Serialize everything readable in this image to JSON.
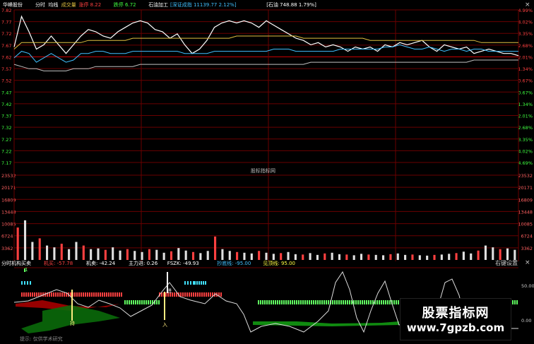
{
  "header": {
    "stock_name": "华峰股份",
    "items": [
      {
        "text": "分时",
        "color": "#ffffff"
      },
      {
        "text": "均线",
        "color": "#ffffff"
      },
      {
        "text": "成交量",
        "color": "#e0c040"
      },
      {
        "text": "涨停 8.22",
        "color": "#ff4040"
      },
      {
        "text": "跌停 6.72",
        "color": "#40ff40"
      },
      {
        "text": "石油加工",
        "color": "#ffffff"
      },
      {
        "text": "[深证成指 11139.77 2.12%]",
        "color": "#40c0ff"
      },
      {
        "text": "[石油 748.88 1.79%]",
        "color": "#ffffff"
      }
    ],
    "close_label": "×"
  },
  "price_axis": {
    "left_labels": [
      "7.82",
      "7.77",
      "7.72",
      "7.67",
      "7.62",
      "7.57",
      "7.52",
      "7.47",
      "7.42",
      "7.37",
      "7.32",
      "7.27",
      "7.22",
      "7.17"
    ],
    "right_labels": [
      "4.99%",
      "4.02%",
      "3.35%",
      "2.68%",
      "2.01%",
      "1.34%",
      "0.67%",
      "0.67%",
      "1.34%",
      "2.01%",
      "2.68%",
      "3.35%",
      "4.02%",
      "4.69%"
    ]
  },
  "volume_axis": {
    "labels": [
      "23532",
      "20171",
      "16809",
      "13448",
      "10085",
      "6724",
      "3362"
    ]
  },
  "center_label": "股标指标网",
  "indicator": {
    "name": "分时机构买卖",
    "items": [
      {
        "text": "机买: -57.78",
        "color": "#ff4040"
      },
      {
        "text": "机卖: -42.24",
        "color": "#ffffff"
      },
      {
        "text": "主力进: 0.26",
        "color": "#ffffff"
      },
      {
        "text": "FSZK: -49.93",
        "color": "#ffffff"
      },
      {
        "text": "抄底线: -95.00",
        "color": "#40c0ff"
      },
      {
        "text": "见顶线: 95.00",
        "color": "#ffff40"
      }
    ],
    "right_button": "右键设置",
    "close_label": "×",
    "axis_labels": [
      "50.00",
      "0.00"
    ],
    "marker_labels": [
      "1",
      "持",
      "进",
      "入"
    ],
    "bottom_note": "提示: 仅供学术研究"
  },
  "chart_data": {
    "type": "line",
    "title": "",
    "price_range": [
      7.12,
      7.82
    ],
    "series": [
      {
        "name": "分时",
        "color": "#ffffff",
        "values": [
          7.65,
          7.79,
          7.72,
          7.64,
          7.66,
          7.7,
          7.66,
          7.62,
          7.66,
          7.7,
          7.73,
          7.72,
          7.7,
          7.69,
          7.72,
          7.74,
          7.76,
          7.77,
          7.76,
          7.73,
          7.72,
          7.69,
          7.71,
          7.66,
          7.62,
          7.64,
          7.68,
          7.74,
          7.76,
          7.77,
          7.76,
          7.77,
          7.76,
          7.74,
          7.77,
          7.75,
          7.73,
          7.71,
          7.69,
          7.68,
          7.66,
          7.67,
          7.65,
          7.66,
          7.65,
          7.63,
          7.65,
          7.64,
          7.65,
          7.63,
          7.66,
          7.65,
          7.67,
          7.66,
          7.67,
          7.68,
          7.65,
          7.63,
          7.66,
          7.65,
          7.64,
          7.65,
          7.62,
          7.63,
          7.64,
          7.63,
          7.62,
          7.62,
          7.61
        ]
      },
      {
        "name": "均线",
        "color": "#e0c040",
        "values": [
          7.64,
          7.67,
          7.67,
          7.67,
          7.67,
          7.67,
          7.67,
          7.67,
          7.67,
          7.67,
          7.68,
          7.68,
          7.68,
          7.68,
          7.68,
          7.68,
          7.69,
          7.69,
          7.69,
          7.69,
          7.69,
          7.69,
          7.69,
          7.69,
          7.69,
          7.69,
          7.69,
          7.69,
          7.69,
          7.69,
          7.7,
          7.7,
          7.7,
          7.7,
          7.7,
          7.7,
          7.7,
          7.7,
          7.7,
          7.69,
          7.69,
          7.69,
          7.69,
          7.69,
          7.69,
          7.69,
          7.69,
          7.69,
          7.68,
          7.68,
          7.68,
          7.68,
          7.68,
          7.68,
          7.68,
          7.68,
          7.68,
          7.68,
          7.68,
          7.68,
          7.68,
          7.68,
          7.68,
          7.67,
          7.67,
          7.67,
          7.67,
          7.67,
          7.67
        ]
      },
      {
        "name": "深证成指",
        "color": "#40c0ff",
        "values": [
          7.6,
          7.63,
          7.62,
          7.58,
          7.6,
          7.62,
          7.6,
          7.58,
          7.59,
          7.62,
          7.62,
          7.63,
          7.63,
          7.62,
          7.62,
          7.62,
          7.63,
          7.63,
          7.63,
          7.63,
          7.63,
          7.63,
          7.63,
          7.62,
          7.62,
          7.62,
          7.62,
          7.63,
          7.63,
          7.63,
          7.63,
          7.63,
          7.63,
          7.63,
          7.63,
          7.64,
          7.64,
          7.64,
          7.63,
          7.63,
          7.63,
          7.63,
          7.63,
          7.63,
          7.64,
          7.64,
          7.64,
          7.64,
          7.64,
          7.64,
          7.65,
          7.65,
          7.66,
          7.65,
          7.64,
          7.64,
          7.65,
          7.64,
          7.63,
          7.64,
          7.64,
          7.63,
          7.64,
          7.64,
          7.63,
          7.63,
          7.63,
          7.63,
          7.63
        ]
      },
      {
        "name": "石油",
        "color": "#c0c0c0",
        "values": [
          7.57,
          7.56,
          7.55,
          7.55,
          7.54,
          7.54,
          7.54,
          7.54,
          7.55,
          7.55,
          7.55,
          7.56,
          7.56,
          7.56,
          7.56,
          7.56,
          7.56,
          7.57,
          7.57,
          7.57,
          7.57,
          7.57,
          7.57,
          7.57,
          7.57,
          7.57,
          7.57,
          7.57,
          7.57,
          7.57,
          7.57,
          7.57,
          7.57,
          7.57,
          7.57,
          7.57,
          7.57,
          7.57,
          7.57,
          7.57,
          7.58,
          7.58,
          7.58,
          7.58,
          7.58,
          7.58,
          7.58,
          7.58,
          7.58,
          7.58,
          7.58,
          7.58,
          7.58,
          7.58,
          7.58,
          7.58,
          7.58,
          7.58,
          7.58,
          7.58,
          7.58,
          7.58,
          7.59,
          7.59,
          7.59,
          7.59,
          7.59,
          7.59,
          7.59
        ]
      }
    ],
    "volume": {
      "max": 23532,
      "values": [
        9000,
        11000,
        5000,
        6000,
        4000,
        3500,
        4500,
        3000,
        5000,
        4000,
        3000,
        3200,
        2800,
        3500,
        2600,
        3000,
        2500,
        2200,
        3000,
        2800,
        2000,
        2400,
        3300,
        2600,
        2200,
        1900,
        2500,
        6500,
        3000,
        2500,
        2200,
        2000,
        1800,
        2500,
        2000,
        1700,
        1900,
        2200,
        1600,
        1500,
        1900,
        1400,
        1800,
        2000,
        1600,
        1500,
        1300,
        1700,
        1500,
        1400,
        1300,
        1600,
        1800,
        1400,
        1500,
        1300,
        1200,
        1400,
        1500,
        1700,
        1900,
        2300,
        1800,
        2600,
        4000,
        3500,
        3000,
        3200,
        2800
      ]
    }
  }
}
